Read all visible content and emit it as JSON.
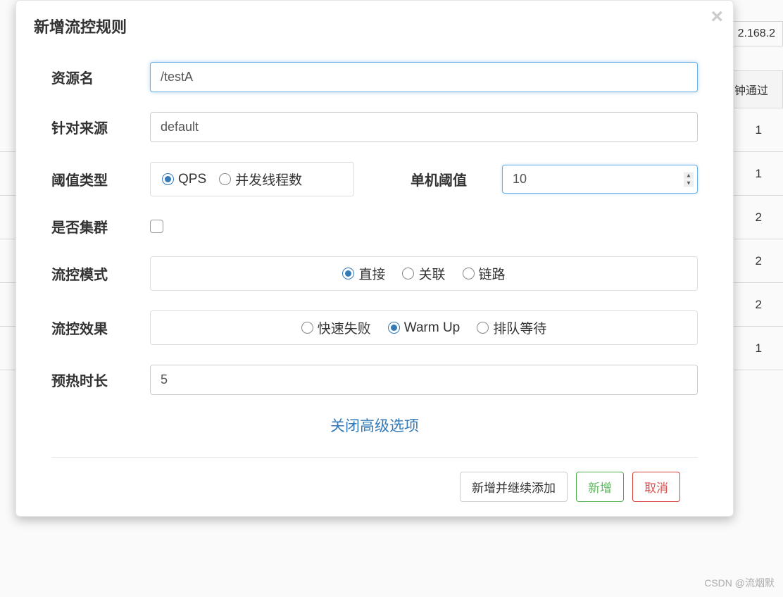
{
  "modal": {
    "title": "新增流控规则",
    "close_advanced_link": "关闭高级选项"
  },
  "fields": {
    "resource_name": {
      "label": "资源名",
      "value": "/testA"
    },
    "source": {
      "label": "针对来源",
      "value": "default"
    },
    "threshold_type": {
      "label": "阈值类型",
      "options": {
        "qps": "QPS",
        "threads": "并发线程数"
      },
      "selected": "qps"
    },
    "single_threshold": {
      "label": "单机阈值",
      "value": "10"
    },
    "is_cluster": {
      "label": "是否集群",
      "checked": false
    },
    "flow_mode": {
      "label": "流控模式",
      "options": {
        "direct": "直接",
        "relate": "关联",
        "chain": "链路"
      },
      "selected": "direct"
    },
    "flow_effect": {
      "label": "流控效果",
      "options": {
        "fail_fast": "快速失败",
        "warm_up": "Warm Up",
        "queue": "排队等待"
      },
      "selected": "warm_up"
    },
    "warmup_time": {
      "label": "预热时长",
      "value": "5"
    }
  },
  "buttons": {
    "add_continue": "新增并继续添加",
    "add": "新增",
    "cancel": "取消"
  },
  "background": {
    "ip_fragment": "2.168.2",
    "col_header": "钟通过",
    "row_values": [
      "1",
      "1",
      "2",
      "2",
      "2",
      "1"
    ]
  },
  "watermark": "CSDN @流烟默"
}
